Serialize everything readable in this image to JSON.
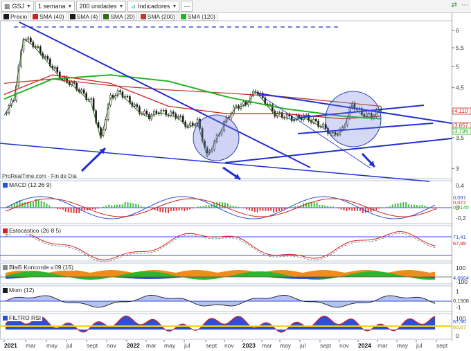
{
  "toolbar": {
    "symbol": "GSJ",
    "period": "1 semana",
    "units": "200 unidades",
    "indicators": "Indicadores"
  },
  "legend": [
    {
      "label": "Precio",
      "color": "#1a1a1a"
    },
    {
      "label": "SMA (40)",
      "color": "#d42020"
    },
    {
      "label": "SMA (4)",
      "color": "#1a1a1a"
    },
    {
      "label": "SMA (20)",
      "color": "#2f6b1a"
    },
    {
      "label": "SMA (200)",
      "color": "#c0392b"
    },
    {
      "label": "SMA (120)",
      "color": "#22b522"
    }
  ],
  "watermark": "ProRealTime.com - Fin de Día",
  "panes": {
    "macd": {
      "label": "MACD (12 26 9)",
      "ticks": [
        "0,4",
        "0",
        "-0,2"
      ],
      "values": [
        "0,097",
        "0,072",
        "0,0145"
      ]
    },
    "stoch": {
      "label": "Estocástico (26 8 5)",
      "values": [
        "71,41",
        "67,88"
      ]
    },
    "koncorde": {
      "label": "Blai5 Koncorde v.09 (15)",
      "ticks": [
        "100",
        "0",
        "-100"
      ],
      "values": [
        "4,6664"
      ]
    },
    "mom": {
      "label": "Mom (12)",
      "ticks": [
        "1",
        "-1"
      ],
      "values": [
        "0,1508"
      ]
    },
    "rsi": {
      "label": "FILTRO RSI",
      "ticks": [
        "100",
        "0"
      ],
      "values": [
        "67,90",
        "60,87"
      ]
    }
  },
  "chart_data": {
    "type": "line",
    "title": "GSJ",
    "x_tick_labels": [
      "2021",
      "mar",
      "may",
      "jul",
      "sept",
      "nov",
      "2022",
      "mar",
      "may",
      "jul",
      "sept",
      "nov",
      "2023",
      "mar",
      "may",
      "jul",
      "sept",
      "nov",
      "2024",
      "mar",
      "may",
      "jul",
      "sept"
    ],
    "y_tick_labels": [
      "6",
      "5,5",
      "5",
      "4,5",
      "4",
      "3,5",
      "3"
    ],
    "y_scale": "log",
    "ylim": [
      2.85,
      6.3
    ],
    "last_price_labels": [
      "4,110",
      "3,857",
      "3,796"
    ],
    "series": [
      {
        "name": "Precio",
        "x": [
          "2021-01",
          "2021-02",
          "2021-03",
          "2021-04",
          "2021-05",
          "2021-06",
          "2021-07",
          "2021-08",
          "2021-09",
          "2021-10",
          "2021-11",
          "2021-12",
          "2022-01",
          "2022-02",
          "2022-03",
          "2022-04",
          "2022-05",
          "2022-06",
          "2022-07",
          "2022-08",
          "2022-09",
          "2022-10",
          "2022-11",
          "2022-12",
          "2023-01",
          "2023-02",
          "2023-03",
          "2023-04",
          "2023-05",
          "2023-06",
          "2023-07",
          "2023-08",
          "2023-09",
          "2023-10",
          "2023-11",
          "2023-12",
          "2024-01",
          "2024-02",
          "2024-03",
          "2024-04"
        ],
        "values": [
          3.95,
          4.25,
          5.8,
          5.6,
          5.3,
          5.0,
          4.7,
          4.6,
          4.4,
          4.2,
          3.5,
          4.3,
          4.4,
          4.2,
          4.0,
          3.9,
          4.0,
          3.95,
          3.9,
          3.7,
          3.8,
          3.2,
          3.5,
          3.85,
          4.1,
          4.15,
          4.45,
          4.2,
          3.95,
          3.9,
          3.85,
          3.9,
          3.8,
          3.7,
          3.55,
          3.65,
          4.15,
          3.95,
          3.9,
          4.05
        ]
      },
      {
        "name": "SMA (40)",
        "x": [
          "2021-01",
          "2021-06",
          "2021-12",
          "2022-06",
          "2022-12",
          "2023-06",
          "2023-12",
          "2024-04"
        ],
        "values": [
          4.35,
          4.8,
          4.6,
          4.1,
          3.95,
          3.95,
          3.85,
          3.9
        ]
      },
      {
        "name": "SMA (200)",
        "x": [
          "2021-01",
          "2021-06",
          "2021-12",
          "2022-06",
          "2022-12",
          "2023-06",
          "2023-12",
          "2024-04"
        ],
        "values": [
          4.6,
          4.7,
          4.55,
          4.45,
          4.38,
          4.3,
          4.18,
          4.1
        ]
      },
      {
        "name": "SMA (120)",
        "x": [
          "2021-01",
          "2021-06",
          "2021-12",
          "2022-06",
          "2022-12",
          "2023-06",
          "2023-12",
          "2024-04"
        ],
        "values": [
          4.25,
          4.7,
          4.8,
          4.65,
          4.3,
          4.05,
          3.9,
          3.85
        ]
      }
    ]
  }
}
